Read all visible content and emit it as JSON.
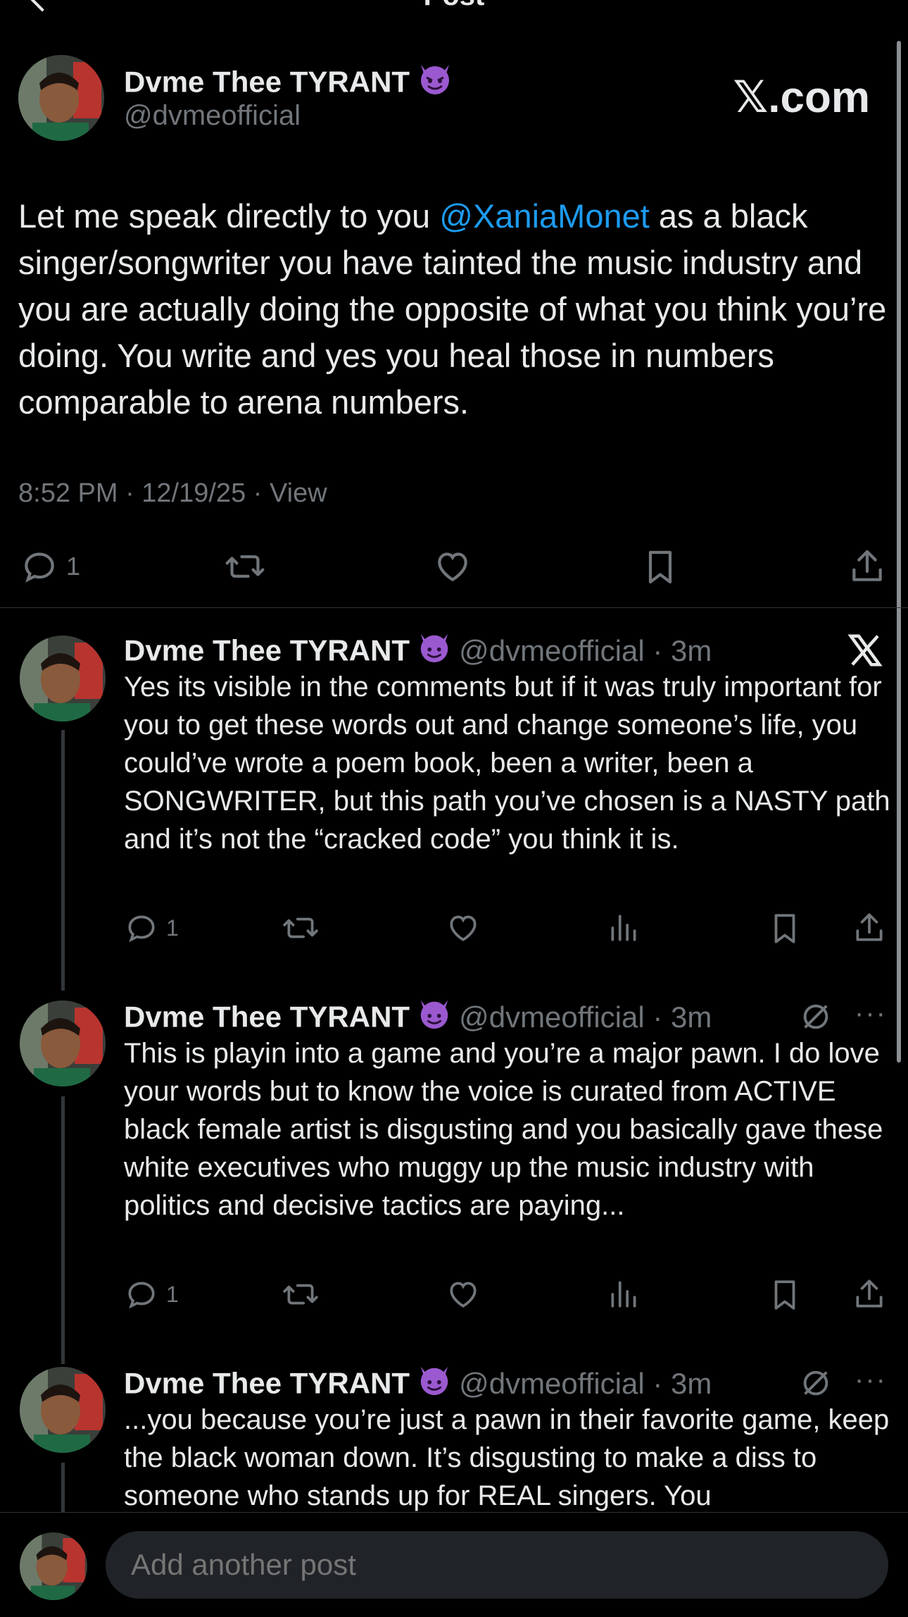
{
  "header": {
    "title": "Post"
  },
  "post": {
    "author": {
      "name": "Dvme Thee TYRANT",
      "handle": "@dvmeofficial",
      "emoji": "😈"
    },
    "brand": "𝕏.com",
    "text_before": "Let me speak directly to you ",
    "mention": "@XaniaMonet",
    "text_after": " as a black singer/songwriter you have tainted the music industry and you are actually doing the opposite of what you think you’re doing. You write and yes you heal those in numbers comparable to arena numbers.",
    "meta": "8:52 PM · 12/19/25 · View",
    "actions": {
      "reply_count": "1"
    }
  },
  "replies": [
    {
      "name": "Dvme Thee TYRANT",
      "handle": "@dvmeofficial · 3m",
      "text": "Yes its visible in the comments but if it was truly important for you to get these words out and change someone’s life, you could’ve wrote a poem book, been a writer, been a SONGWRITER, but this path you’ve chosen is a NASTY path and it’s not the “cracked code” you think it is.",
      "reply_count": "1"
    },
    {
      "name": "Dvme Thee TYRANT",
      "handle": "@dvmeofficial · 3m",
      "text": "This is playin into a game and you’re a major pawn. I do love your words but to know the voice is curated from ACTIVE black female artist is disgusting and you basically gave these white executives who muggy up the music industry with politics and decisive tactics are paying...",
      "reply_count": "1"
    },
    {
      "name": "Dvme Thee TYRANT",
      "handle": "@dvmeofficial · 3m",
      "text": "...you because you’re just a pawn in their favorite game, keep the black woman down. It’s disgusting to make a diss to someone who stands up for REAL singers. You"
    }
  ],
  "more_label": "···",
  "composer": {
    "placeholder": "Add another post"
  },
  "icons": [
    "back-chevron-icon",
    "reply-icon",
    "repost-icon",
    "like-icon",
    "bookmark-icon",
    "share-icon",
    "views-icon",
    "x-logo-icon",
    "grok-icon",
    "more-icon"
  ],
  "colors": {
    "background": "#000000",
    "text": "#e7e9ea",
    "muted": "#71767b",
    "link": "#1d9bf0"
  }
}
